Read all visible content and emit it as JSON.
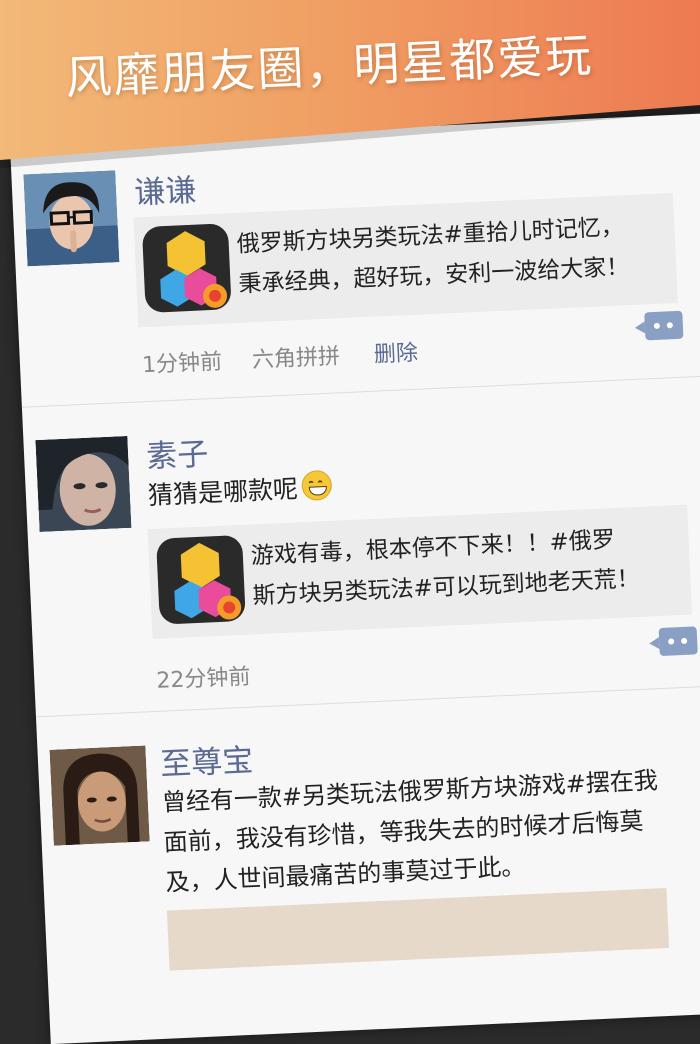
{
  "banner": {
    "headline": "风靡朋友圈，明星都爱玩",
    "colors": {
      "start": "#f2b978",
      "end": "#ee7a52"
    }
  },
  "feed": {
    "posts": [
      {
        "name": "谦谦",
        "share_text_line1": "俄罗斯方块另类玩法#重拾儿时记忆，",
        "share_text_line2": "秉承经典，超好玩，安利一波给大家！",
        "time": "1分钟前",
        "source": "六角拼拼",
        "delete_label": "删除"
      },
      {
        "name": "素子",
        "text": "猜猜是哪款呢",
        "share_text_line1": "游戏有毒，根本停不下来！！#俄罗",
        "share_text_line2": "斯方块另类玩法#可以玩到地老天荒！",
        "time": "22分钟前"
      },
      {
        "name": "至尊宝",
        "text_line1": "曾经有一款#另类玩法俄罗斯方块游戏#摆在我",
        "text_line2": "面前，我没有珍惜，等我失去的时候才后悔莫",
        "text_line3": "及，人世间最痛苦的事莫过于此。"
      }
    ]
  },
  "icons": {
    "app_icon": "hexagon-puzzle-app-icon",
    "comment": "comment-bubble-icon",
    "emoji": "grinning-face-emoji"
  },
  "accent_colors": {
    "name": "#5b6a92",
    "comment_button": "#8a9fc4"
  }
}
